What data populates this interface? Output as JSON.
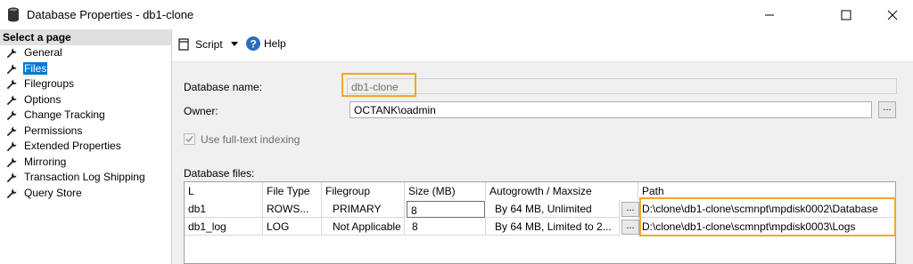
{
  "window": {
    "title": "Database Properties - db1-clone",
    "icon": "database-icon"
  },
  "sidebar": {
    "header": "Select a page",
    "items": [
      {
        "label": "General"
      },
      {
        "label": "Files",
        "selected": true
      },
      {
        "label": "Filegroups"
      },
      {
        "label": "Options"
      },
      {
        "label": "Change Tracking"
      },
      {
        "label": "Permissions"
      },
      {
        "label": "Extended Properties"
      },
      {
        "label": "Mirroring"
      },
      {
        "label": "Transaction Log Shipping"
      },
      {
        "label": "Query Store"
      }
    ]
  },
  "toolbar": {
    "script_label": "Script",
    "help_label": "Help"
  },
  "form": {
    "database_name_label": "Database name:",
    "database_name_value": "db1-clone",
    "owner_label": "Owner:",
    "owner_value": "OCTANK\\oadmin",
    "owner_browse": "...",
    "fulltext_label": "Use full-text indexing",
    "fulltext_checked": true
  },
  "files": {
    "label": "Database files:",
    "columns": [
      "L",
      "File Type",
      "Filegroup",
      "Size (MB)",
      "Autogrowth / Maxsize",
      "Path"
    ],
    "rows": [
      {
        "name": "db1",
        "type": "ROWS...",
        "filegroup": "PRIMARY",
        "size": "8",
        "autogrowth": "By 64 MB, Unlimited",
        "browse": "...",
        "path": "D:\\clone\\db1-clone\\scmnpt\\mpdisk0002\\Database"
      },
      {
        "name": "db1_log",
        "type": "LOG",
        "filegroup": "Not Applicable",
        "size": "8",
        "autogrowth": "By 64 MB, Limited to 2...",
        "browse": "...",
        "path": "D:\\clone\\db1-clone\\scmnpt\\mpdisk0003\\Logs"
      }
    ]
  },
  "colors": {
    "highlight": "#f5a623",
    "selection": "#0078d7"
  }
}
